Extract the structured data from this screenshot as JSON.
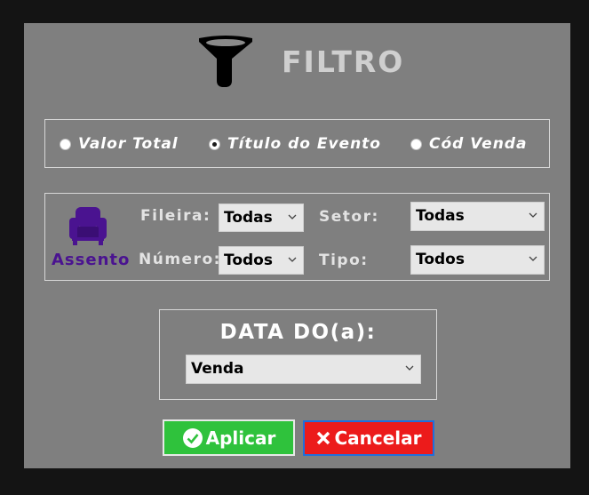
{
  "header": {
    "title": "FILTRO",
    "icon": "funnel-icon"
  },
  "search_by": {
    "options": [
      {
        "label": "Valor Total",
        "checked": false
      },
      {
        "label": "Título do Evento",
        "checked": true
      },
      {
        "label": "Cód Venda",
        "checked": false
      }
    ]
  },
  "seat": {
    "icon": "armchair-icon",
    "label": "Assento",
    "row_label": "Fileira:",
    "row_value": "Todas",
    "sector_label": "Setor:",
    "sector_value": "Todas",
    "number_label": "Número:",
    "number_value": "Todos",
    "type_label": "Tipo:",
    "type_value": "Todos"
  },
  "date": {
    "title": "DATA DO(a):",
    "value": "Venda"
  },
  "buttons": {
    "apply_label": "Aplicar",
    "cancel_label": "Cancelar"
  },
  "colors": {
    "dialog_bg": "#7f7f7f",
    "accent_purple": "#4a1390",
    "apply_green": "#2fc23c",
    "cancel_red": "#ec1b1b"
  }
}
